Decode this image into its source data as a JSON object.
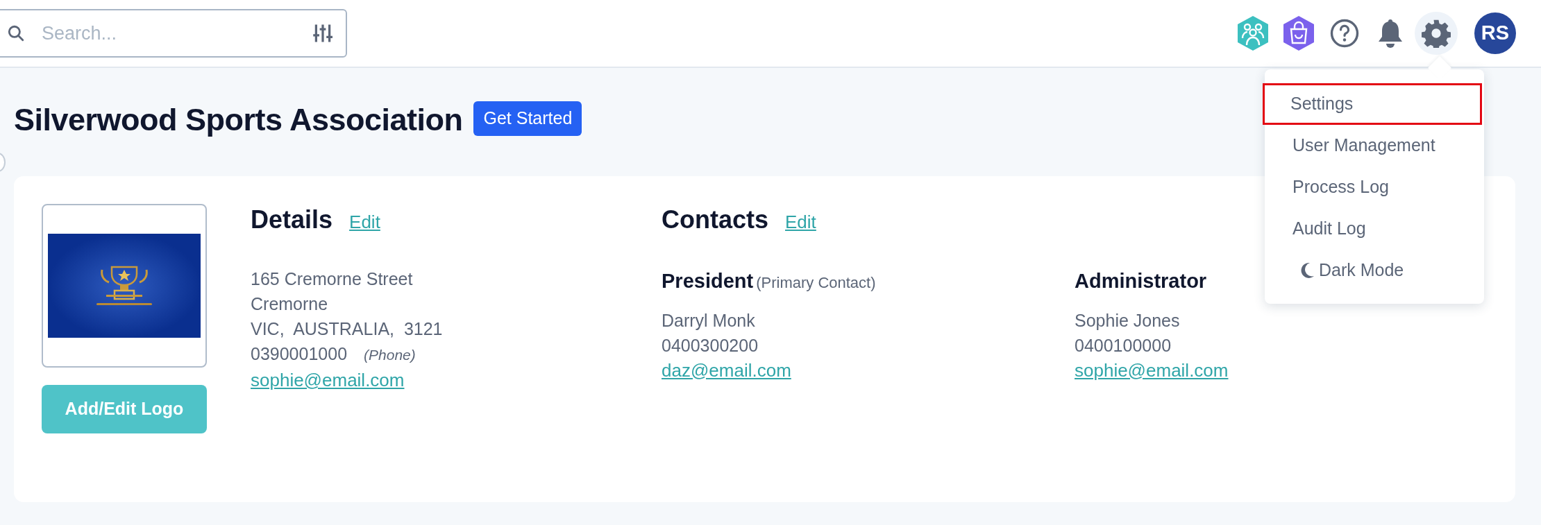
{
  "search": {
    "placeholder": "Search..."
  },
  "header_icons": [
    {
      "kind": "people"
    },
    {
      "kind": "bag"
    },
    {
      "kind": "help"
    },
    {
      "kind": "bell"
    },
    {
      "kind": "gear",
      "selected": true
    }
  ],
  "avatar": {
    "initials": "RS"
  },
  "page": {
    "title": "Silverwood Sports Association",
    "action": "Get Started"
  },
  "logo": {
    "kind": "picture",
    "button": "Add/Edit Logo"
  },
  "details": {
    "heading": "Details",
    "edit": "Edit",
    "lines": [
      "165 Cremorne Street",
      "Cremorne",
      "VIC,  AUSTRALIA,  3121"
    ],
    "phone": "0390001000",
    "phone_label": "(Phone)",
    "email": "sophie@email.com"
  },
  "contacts": {
    "heading": "Contacts",
    "edit": "Edit",
    "people": [
      {
        "role": "President",
        "note": "(Primary Contact)",
        "name": "Darryl Monk",
        "phone": "0400300200",
        "email": "daz@email.com"
      },
      {
        "role": "Administrator",
        "name": "Sophie Jones",
        "phone": "0400100000",
        "email": "sophie@email.com"
      }
    ]
  },
  "settings_menu": {
    "items": [
      {
        "label": "Settings",
        "kind": "link",
        "highlighted": true
      },
      {
        "label": "User Management",
        "kind": "link",
        "highlighted": false
      },
      {
        "label": "Process Log",
        "kind": "link",
        "highlighted": false
      },
      {
        "label": "Audit Log",
        "kind": "link",
        "highlighted": false
      },
      {
        "label": "Dark Mode",
        "kind": "toggle",
        "highlighted": false
      }
    ]
  }
}
